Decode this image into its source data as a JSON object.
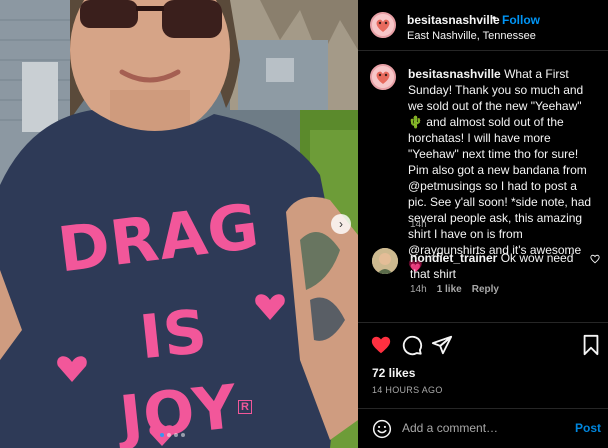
{
  "post": {
    "author": {
      "username": "besitasnashville",
      "follow_label": "Follow",
      "location": "East Nashville, Tennessee"
    },
    "caption": {
      "username": "besitasnashville",
      "text": "What a First Sunday! Thank you so much and we sold out of the new \"Yeehaw\" 🌵 and almost sold out of the horchatas! I will have more \"Yeehaw\" next time tho for sure! Pim also got a new bandana from @petmusings so I had to post a pic. See y'all soon! *side note, had several people ask, this amazing shirt I have on is from @raygunshirts and it's awesome 💗",
      "time": "14h"
    },
    "comments": [
      {
        "username": "nondiet_trainer",
        "text": "Ok wow need that shirt",
        "time": "14h",
        "likes": "1 like",
        "reply_label": "Reply"
      }
    ],
    "likes": "72 likes",
    "posted_ago": "14 HOURS AGO",
    "add_comment_placeholder": "Add a comment…",
    "post_label": "Post",
    "shirt_text": [
      "DRAG",
      "IS",
      "JOY"
    ],
    "shirt_mark": "R",
    "carousel": {
      "total": 4,
      "active": 1
    }
  },
  "colors": {
    "accent": "#0095f6",
    "like_red": "#ff3040",
    "shirt_pink": "#f2579a",
    "shirt_navy": "#2e3a57",
    "background": "#000000"
  },
  "icons": {
    "like": "heart-filled-icon",
    "comment": "comment-bubble-icon",
    "share": "paper-plane-icon",
    "save": "bookmark-icon",
    "emoji": "smiley-icon",
    "next": "chevron-right-icon"
  }
}
